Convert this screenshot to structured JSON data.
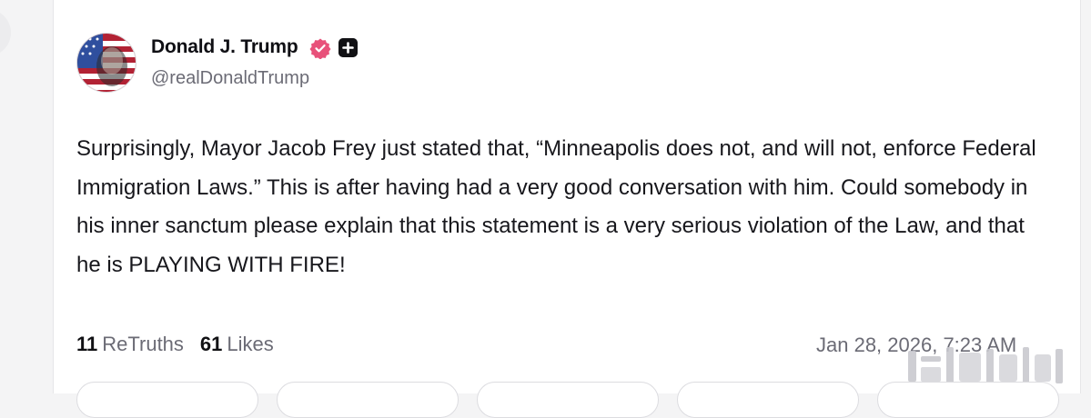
{
  "author": {
    "name": "Donald J. Trump",
    "handle": "@realDonaldTrump",
    "avatar_icon": "avatar-flag-portrait",
    "verified_icon": "verified-badge-icon",
    "plus_icon": "plus-badge-icon"
  },
  "post": {
    "text": "Surprisingly, Mayor Jacob Frey just stated that, “Minneapolis does not, and will not, enforce Federal Immigration Laws.” This is after having had a very good conversation with him. Could somebody in his inner sanctum please explain that this statement is a very serious violation of the Law, and that he is PLAYING WITH FIRE!"
  },
  "stats": {
    "retruths_count": "11",
    "retruths_label": "ReTruths",
    "likes_count": "61",
    "likes_label": "Likes"
  },
  "timestamp": "Jan 28, 2026, 7:23 AM",
  "colors": {
    "verified": "#e8517a",
    "text": "#17171c",
    "muted": "#6b6b75"
  }
}
